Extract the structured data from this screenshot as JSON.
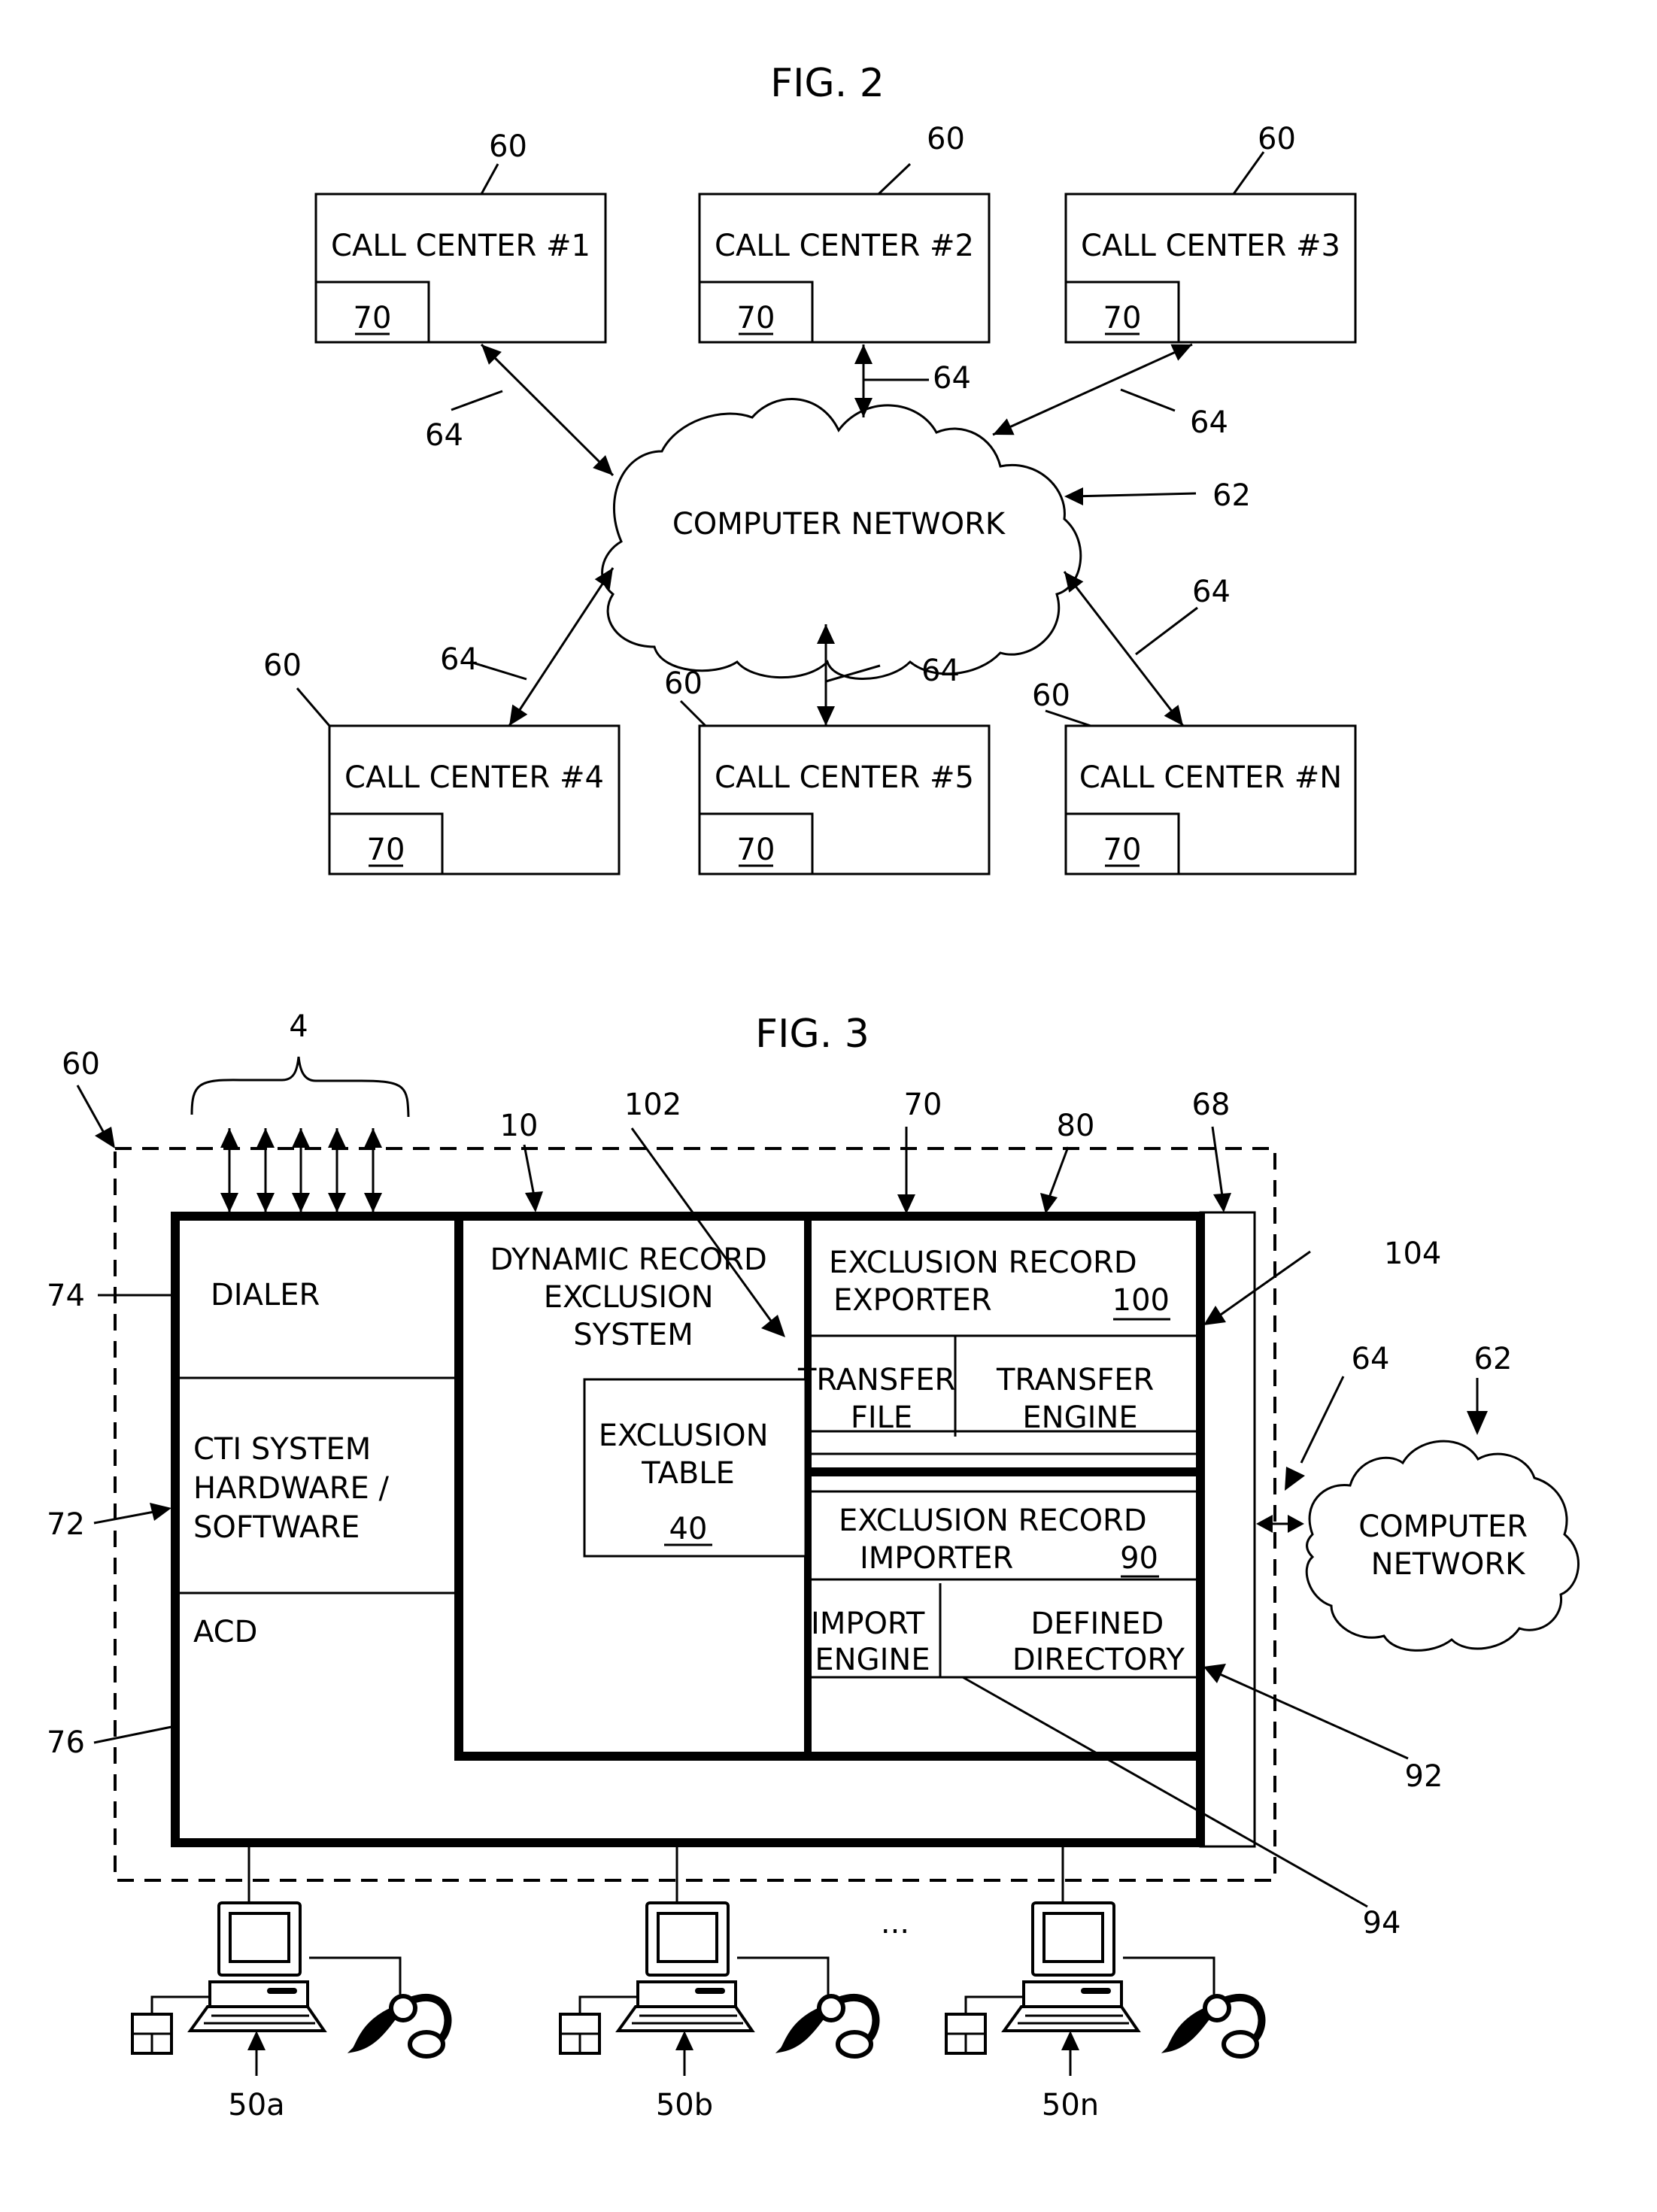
{
  "fig2": {
    "title": "FIG. 2",
    "network_label": "COMPUTER NETWORK",
    "network_ref": "62",
    "link_ref": "64",
    "call_centers": [
      {
        "label": "CALL CENTER #1",
        "ref": "60",
        "inner_ref": "70"
      },
      {
        "label": "CALL CENTER #2",
        "ref": "60",
        "inner_ref": "70"
      },
      {
        "label": "CALL CENTER #3",
        "ref": "60",
        "inner_ref": "70"
      },
      {
        "label": "CALL CENTER #4",
        "ref": "60",
        "inner_ref": "70"
      },
      {
        "label": "CALL CENTER #5",
        "ref": "60",
        "inner_ref": "70"
      },
      {
        "label": "CALL CENTER #N",
        "ref": "60",
        "inner_ref": "70"
      }
    ]
  },
  "fig3": {
    "title": "FIG. 3",
    "refs": {
      "call_center": "60",
      "lines": "4",
      "dres": "10",
      "arrow_102": "102",
      "module": "70",
      "block_80": "80",
      "side_bus": "68",
      "transfer_engine": "104",
      "link": "64",
      "network": "62",
      "dialer": "74",
      "cti": "72",
      "acd": "76",
      "defined_dir": "92",
      "import_engine": "94"
    },
    "dialer": "DIALER",
    "cti": [
      "CTI SYSTEM",
      "HARDWARE /",
      "SOFTWARE"
    ],
    "acd": "ACD",
    "dres": [
      "DYNAMIC RECORD",
      "EXCLUSION",
      "SYSTEM"
    ],
    "exclusion_table": [
      "EXCLUSION",
      "TABLE"
    ],
    "exclusion_table_ref": "40",
    "exporter": [
      "EXCLUSION RECORD",
      "EXPORTER"
    ],
    "exporter_ref": "100",
    "transfer_file": [
      "TRANSFER",
      "FILE"
    ],
    "transfer_engine": [
      "TRANSFER",
      "ENGINE"
    ],
    "importer": [
      "EXCLUSION RECORD",
      "IMPORTER"
    ],
    "importer_ref": "90",
    "import_engine": [
      "IMPORT",
      "ENGINE"
    ],
    "defined_directory": [
      "DEFINED",
      "DIRECTORY"
    ],
    "network_label": [
      "COMPUTER",
      "NETWORK"
    ],
    "ellipsis": "...",
    "workstations": [
      {
        "ref": "50a"
      },
      {
        "ref": "50b"
      },
      {
        "ref": "50n"
      }
    ]
  }
}
